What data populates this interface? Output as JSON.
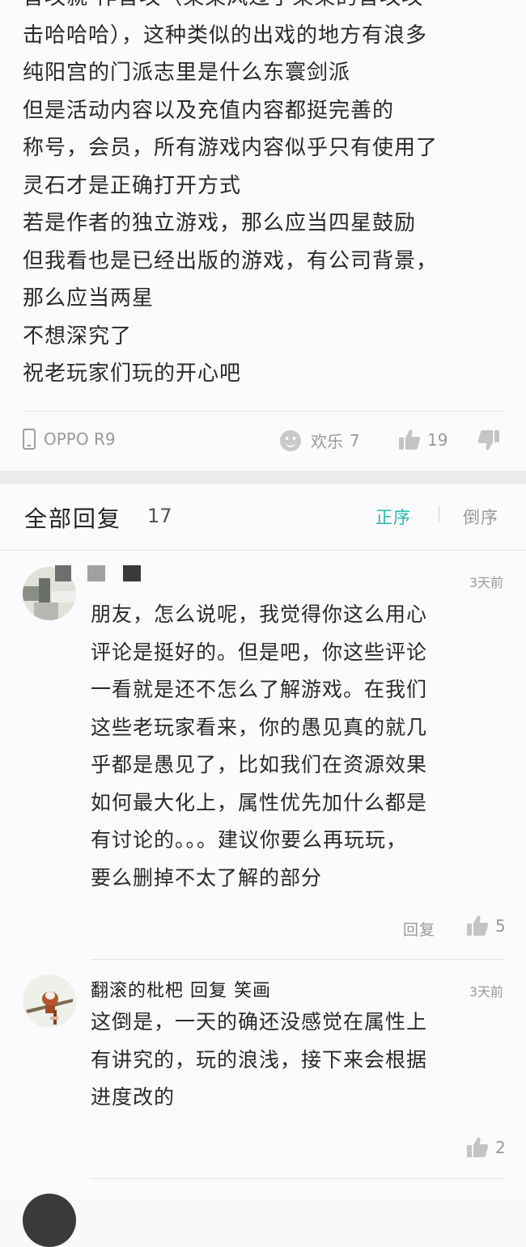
{
  "post": {
    "lines": [
      "音攻就 作音攻（某某风过了某某的音攻攻",
      "击哈哈哈），这种类似的出戏的地方有浪多",
      "纯阳宫的门派志里是什么东寰剑派",
      "但是活动内容以及充值内容都挺完善的",
      "称号，会员，所有游戏内容似乎只有使用了",
      "灵石才是正确打开方式",
      "若是作者的独立游戏，那么应当四星鼓励",
      "但我看也是已经出版的游戏，有公司背景，",
      "那么应当两星",
      "不想深究了",
      "祝老玩家们玩的开心吧"
    ],
    "device": "OPPO R9",
    "joy_label": "欢乐",
    "joy_count": "7",
    "like_count": "19"
  },
  "replies": {
    "title": "全部回复",
    "count": "17",
    "sort_asc": "正序",
    "sort_desc": "倒序"
  },
  "comments": [
    {
      "time": "3天前",
      "lines": [
        "朋友，怎么说呢，我觉得你这么用心",
        "评论是挺好的。但是吧，你这些评论",
        "一看就是还不怎么了解游戏。在我们",
        "这些老玩家看来，你的愚见真的就几",
        "乎都是愚见了，比如我们在资源效果",
        "如何最大化上，属性优先加什么都是",
        "有讨论的。。。建议你要么再玩玩，",
        "要么删掉不太了解的部分"
      ],
      "reply_label": "回复",
      "like_count": "5"
    },
    {
      "name": "翻滚的枇杷 回复 笑画",
      "time": "3天前",
      "lines": [
        "这倒是，一天的确还没感觉在属性上",
        "有讲究的，玩的浪浅，接下来会根据",
        "进度改的"
      ],
      "like_count": "2"
    }
  ]
}
